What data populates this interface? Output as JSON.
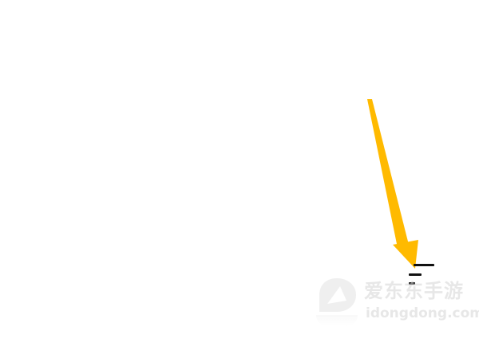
{
  "menu_button": {
    "icon": "menu-icon"
  },
  "annotation_arrow": {
    "color": "#FFBA00",
    "points_to": "menu-icon"
  },
  "watermark": {
    "title": "爱东东手游",
    "site": "idongdong.com",
    "color": "#d4d4d4"
  }
}
